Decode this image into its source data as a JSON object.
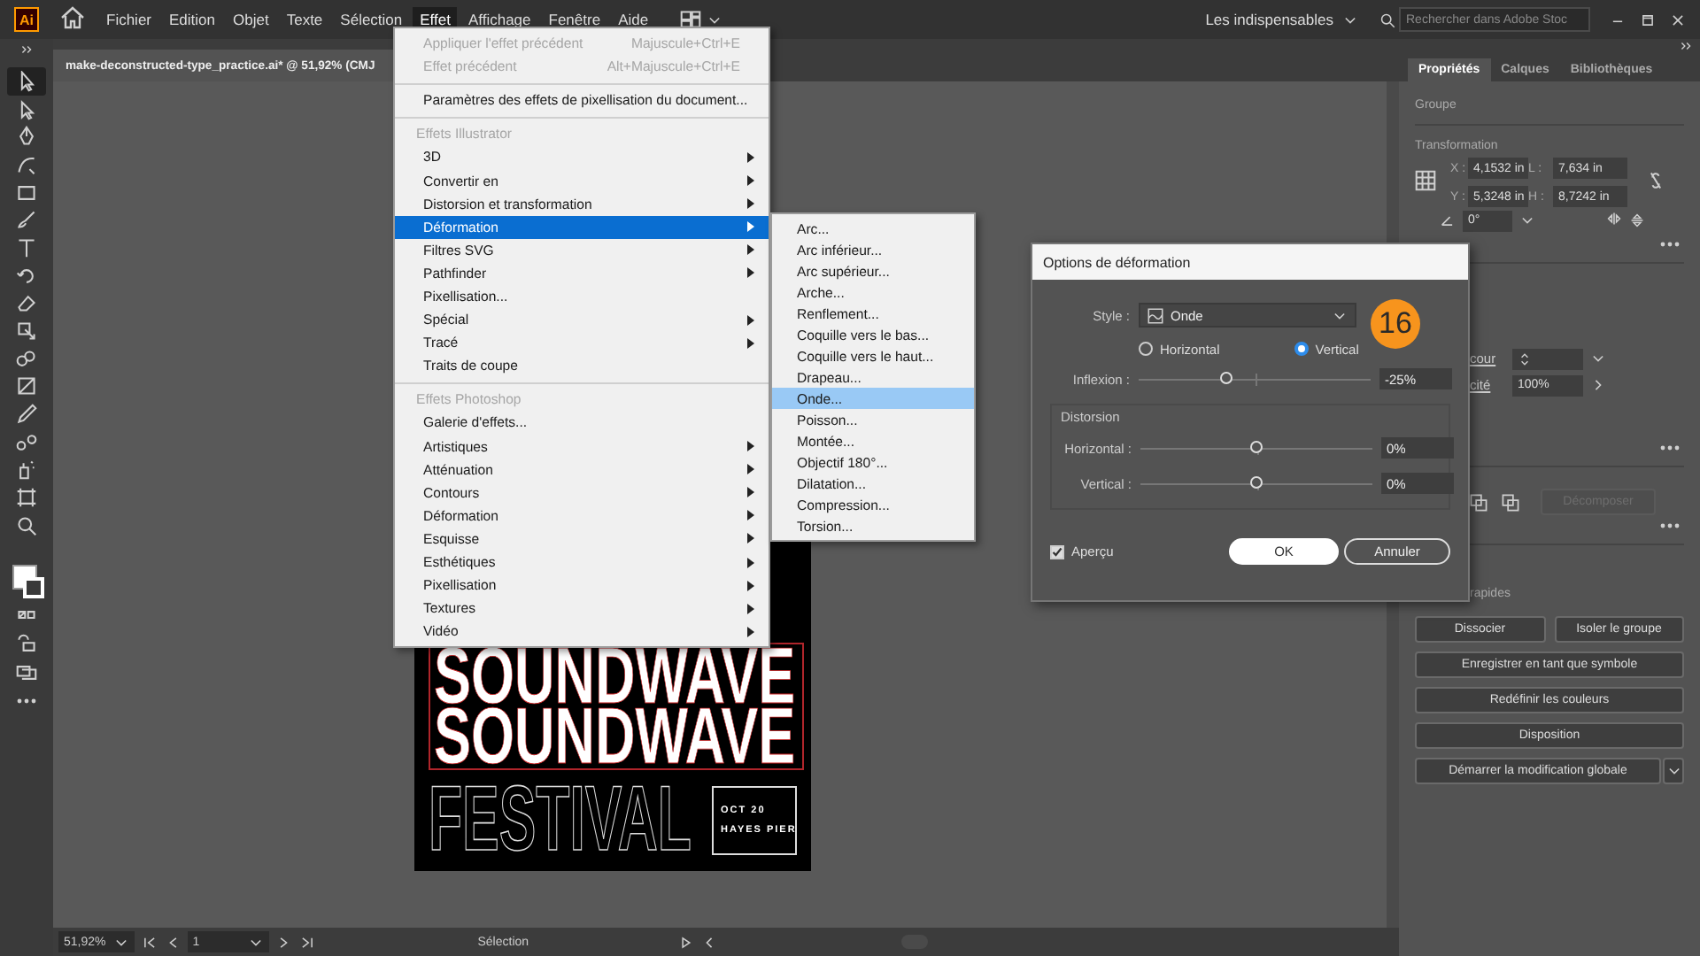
{
  "app": {
    "logo": "Ai"
  },
  "menu_bar": [
    {
      "label": "Fichier",
      "selected": false
    },
    {
      "label": "Edition",
      "selected": false
    },
    {
      "label": "Objet",
      "selected": false
    },
    {
      "label": "Texte",
      "selected": false
    },
    {
      "label": "Sélection",
      "selected": false
    },
    {
      "label": "Effet",
      "selected": true
    },
    {
      "label": "Affichage",
      "selected": false
    },
    {
      "label": "Fenêtre",
      "selected": false
    },
    {
      "label": "Aide",
      "selected": false
    }
  ],
  "workspace": {
    "label": "Les indispensables"
  },
  "stock_search": {
    "placeholder": "Rechercher dans Adobe Stoc"
  },
  "document_tab": {
    "title": "make-deconstructed-type_practice.ai* @ 51,92% (CMJ"
  },
  "effect_menu": [
    {
      "kind": "item",
      "label": "Appliquer l'effet précédent",
      "shortcut": "Majuscule+Ctrl+E",
      "submenu": false,
      "disabled": true,
      "selected": false
    },
    {
      "kind": "item",
      "label": "Effet précédent",
      "shortcut": "Alt+Majuscule+Ctrl+E",
      "submenu": false,
      "disabled": true,
      "selected": false
    },
    {
      "kind": "separator"
    },
    {
      "kind": "item",
      "label": "Paramètres des effets de pixellisation du document...",
      "submenu": false,
      "disabled": false,
      "selected": false
    },
    {
      "kind": "separator"
    },
    {
      "kind": "header",
      "label": "Effets Illustrator"
    },
    {
      "kind": "item",
      "label": "3D",
      "submenu": true,
      "disabled": false,
      "selected": false
    },
    {
      "kind": "item",
      "label": "Convertir en",
      "submenu": true,
      "disabled": false,
      "selected": false
    },
    {
      "kind": "item",
      "label": "Distorsion et transformation",
      "submenu": true,
      "disabled": false,
      "selected": false
    },
    {
      "kind": "item",
      "label": "Déformation",
      "submenu": true,
      "disabled": false,
      "selected": true
    },
    {
      "kind": "item",
      "label": "Filtres SVG",
      "submenu": true,
      "disabled": false,
      "selected": false
    },
    {
      "kind": "item",
      "label": "Pathfinder",
      "submenu": true,
      "disabled": false,
      "selected": false
    },
    {
      "kind": "item",
      "label": "Pixellisation...",
      "submenu": false,
      "disabled": false,
      "selected": false
    },
    {
      "kind": "item",
      "label": "Spécial",
      "submenu": true,
      "disabled": false,
      "selected": false
    },
    {
      "kind": "item",
      "label": "Tracé",
      "submenu": true,
      "disabled": false,
      "selected": false
    },
    {
      "kind": "item",
      "label": "Traits de coupe",
      "submenu": false,
      "disabled": false,
      "selected": false
    },
    {
      "kind": "separator"
    },
    {
      "kind": "header",
      "label": "Effets Photoshop"
    },
    {
      "kind": "item",
      "label": "Galerie d'effets...",
      "submenu": false,
      "disabled": false,
      "selected": false
    },
    {
      "kind": "item",
      "label": "Artistiques",
      "submenu": true,
      "disabled": false,
      "selected": false
    },
    {
      "kind": "item",
      "label": "Atténuation",
      "submenu": true,
      "disabled": false,
      "selected": false
    },
    {
      "kind": "item",
      "label": "Contours",
      "submenu": true,
      "disabled": false,
      "selected": false
    },
    {
      "kind": "item",
      "label": "Déformation",
      "submenu": true,
      "disabled": false,
      "selected": false
    },
    {
      "kind": "item",
      "label": "Esquisse",
      "submenu": true,
      "disabled": false,
      "selected": false
    },
    {
      "kind": "item",
      "label": "Esthétiques",
      "submenu": true,
      "disabled": false,
      "selected": false
    },
    {
      "kind": "item",
      "label": "Pixellisation",
      "submenu": true,
      "disabled": false,
      "selected": false
    },
    {
      "kind": "item",
      "label": "Textures",
      "submenu": true,
      "disabled": false,
      "selected": false
    },
    {
      "kind": "item",
      "label": "Vidéo",
      "submenu": true,
      "disabled": false,
      "selected": false
    }
  ],
  "warp_submenu": [
    {
      "label": "Arc...",
      "selected": false
    },
    {
      "label": "Arc inférieur...",
      "selected": false
    },
    {
      "label": "Arc supérieur...",
      "selected": false
    },
    {
      "label": "Arche...",
      "selected": false
    },
    {
      "label": "Renflement...",
      "selected": false
    },
    {
      "label": "Coquille vers le bas...",
      "selected": false
    },
    {
      "label": "Coquille vers le haut...",
      "selected": false
    },
    {
      "label": "Drapeau...",
      "selected": false
    },
    {
      "label": "Onde...",
      "selected": true
    },
    {
      "label": "Poisson...",
      "selected": false
    },
    {
      "label": "Montée...",
      "selected": false
    },
    {
      "label": "Objectif 180°...",
      "selected": false
    },
    {
      "label": "Dilatation...",
      "selected": false
    },
    {
      "label": "Compression...",
      "selected": false
    },
    {
      "label": "Torsion...",
      "selected": false
    }
  ],
  "artwork": {
    "lines": [
      "SOUNDWAVE",
      "SOUNDWAVE"
    ],
    "title": "FESTIVAL",
    "date": "OCT 20",
    "venue": "HAYES PIER"
  },
  "warp_dialog": {
    "title": "Options de déformation",
    "style_label": "Style :",
    "style_value": "Onde",
    "orientation": [
      {
        "label": "Horizontal",
        "selected": false
      },
      {
        "label": "Vertical",
        "selected": true
      }
    ],
    "inflexion": {
      "label": "Inflexion :",
      "level": 0.38,
      "value": "-25%"
    },
    "distortion": {
      "title": "Distorsion",
      "sliders": [
        {
          "label": "Horizontal :",
          "level": 0.5,
          "value": "0%"
        },
        {
          "label": "Vertical :",
          "level": 0.5,
          "value": "0%"
        }
      ]
    },
    "preview": {
      "label": "Aperçu",
      "checked": true
    },
    "buttons": [
      {
        "label": "OK",
        "kind": "primary"
      },
      {
        "label": "Annuler",
        "kind": "secondary"
      }
    ],
    "step_badge": "16"
  },
  "properties_panel": {
    "tabs": [
      {
        "label": "Propriétés",
        "selected": true
      },
      {
        "label": "Calques",
        "selected": false
      },
      {
        "label": "Bibliothèques",
        "selected": false
      }
    ],
    "object_type": "Groupe",
    "transform": {
      "title": "Transformation",
      "fields": [
        {
          "label": "X :",
          "value": "4,1532 in"
        },
        {
          "label": "L :",
          "value": "7,634 in"
        },
        {
          "label": "Y :",
          "value": "5,3248 in"
        },
        {
          "label": "H :",
          "value": "8,7242 in"
        }
      ],
      "angle": "0°"
    },
    "appearance": {
      "stroke_label": "cour",
      "opacity_label": "cité",
      "opacity": "100%"
    },
    "pathfinder": {
      "label": "Décomposer",
      "disabled": true
    },
    "quick_actions": {
      "title": "rapides",
      "buttons": [
        {
          "label": "Dissocier",
          "kind": "half"
        },
        {
          "label": "Isoler le groupe",
          "kind": "half"
        },
        {
          "label": "Enregistrer en tant que symbole",
          "kind": "full"
        },
        {
          "label": "Redéfinir les couleurs",
          "kind": "full"
        },
        {
          "label": "Disposition",
          "kind": "full"
        },
        {
          "label": "Démarrer la modification globale",
          "kind": "split"
        }
      ]
    }
  },
  "status_bar": {
    "zoom": "51,92%",
    "artboard": "1",
    "tool": "Sélection"
  }
}
